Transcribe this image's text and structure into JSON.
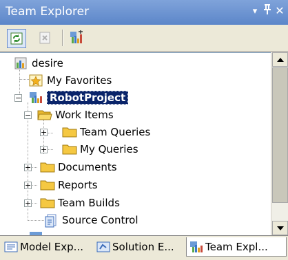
{
  "window": {
    "title": "Team Explorer",
    "dropdown_glyph": "▾",
    "pin_glyph": "ᛜ",
    "close_glyph": "✕"
  },
  "toolbar": {
    "icons": [
      "refresh-icon",
      "stop-icon",
      "add-team-project-icon"
    ]
  },
  "tree": {
    "server": "desire",
    "favorites": "My Favorites",
    "project": "RobotProject",
    "work_items": "Work Items",
    "team_queries": "Team Queries",
    "my_queries": "My Queries",
    "documents": "Documents",
    "reports": "Reports",
    "team_builds": "Team Builds",
    "source_control": "Source Control"
  },
  "tabs": [
    {
      "label": "Model Exp...",
      "icon": "model-explorer-icon"
    },
    {
      "label": "Solution E...",
      "icon": "solution-explorer-icon"
    },
    {
      "label": "Team Expl...",
      "icon": "team-explorer-icon"
    }
  ],
  "colors": {
    "titlebar": "#6b93d3",
    "selection": "#0a246a",
    "folder": "#f5c842"
  }
}
